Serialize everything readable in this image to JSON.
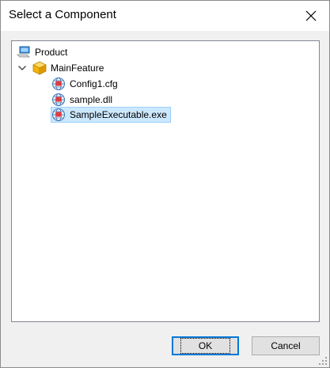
{
  "window": {
    "title": "Select a Component",
    "close_icon": "close-icon"
  },
  "tree": {
    "root": {
      "label": "Product",
      "icon": "computer-icon"
    },
    "feature": {
      "label": "MainFeature",
      "icon": "package-box-icon",
      "expanded": true
    },
    "components": [
      {
        "label": "Config1.cfg",
        "icon": "component-globe-icon",
        "selected": false
      },
      {
        "label": "sample.dll",
        "icon": "component-globe-icon",
        "selected": false
      },
      {
        "label": "SampleExecutable.exe",
        "icon": "component-globe-icon",
        "selected": true
      }
    ]
  },
  "buttons": {
    "ok_label": "OK",
    "cancel_label": "Cancel"
  }
}
